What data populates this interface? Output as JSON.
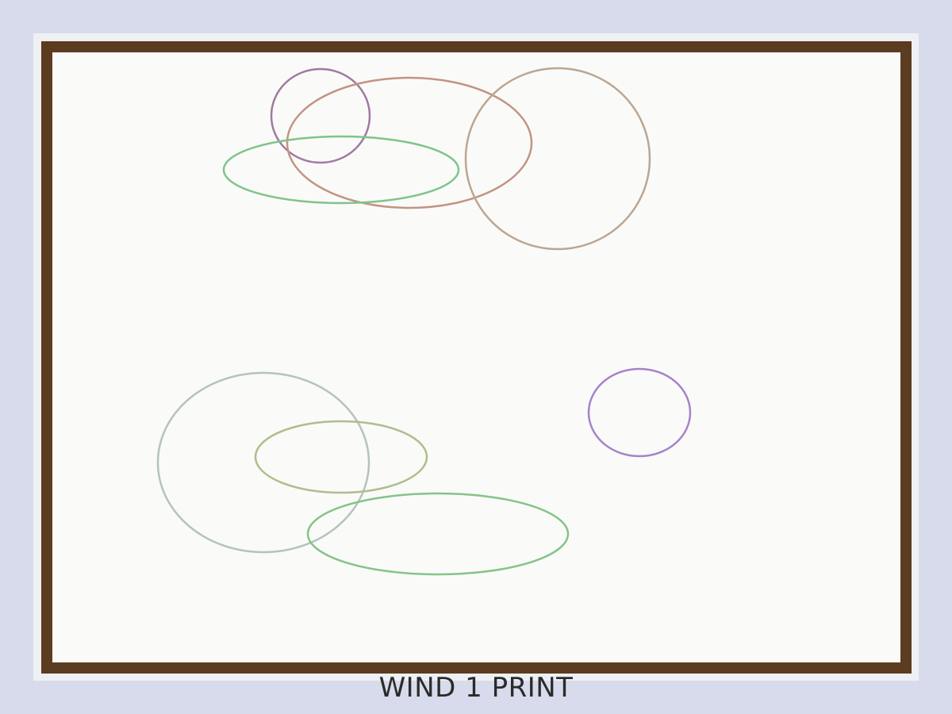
{
  "artwork": {
    "caption": "WIND 1 PRINT",
    "frame_color": "#5b3c20",
    "paper_color": "#fafaf9",
    "background_color": "#d7dbeb",
    "shapes": [
      {
        "name": "plum-circle",
        "color": "#a07aa0"
      },
      {
        "name": "terracotta-ellipse",
        "color": "#c29482"
      },
      {
        "name": "green-ellipse-top",
        "color": "#7fc48a"
      },
      {
        "name": "tan-circle",
        "color": "#bba690"
      },
      {
        "name": "gray-green-circle",
        "color": "#b4c3bd"
      },
      {
        "name": "olive-ellipse",
        "color": "#aebf8a"
      },
      {
        "name": "green-ellipse-bottom",
        "color": "#84c487"
      },
      {
        "name": "violet-circle",
        "color": "#a583c9"
      }
    ]
  }
}
